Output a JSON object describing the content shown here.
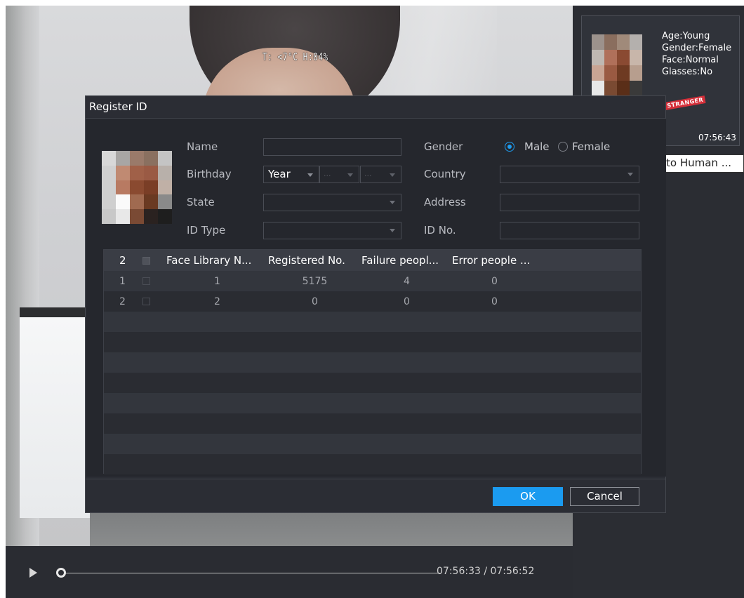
{
  "video": {
    "osd_text": "T: <7°C H:04%"
  },
  "playback": {
    "time": "07:56:33 / 07:56:52",
    "progress": 0.0
  },
  "right_panel": {
    "attributes": [
      "Age:Young",
      "Gender:Female",
      "Face:Normal",
      "Glasses:No"
    ],
    "stamp": "STRANGER",
    "capture_time": "07:56:43",
    "to_human_button": "to Human ..."
  },
  "dialog": {
    "title": "Register ID",
    "form": {
      "name_label": "Name",
      "name_value": "",
      "gender_label": "Gender",
      "gender_options": [
        "Male",
        "Female"
      ],
      "gender_selected": "Male",
      "birthday_label": "Birthday",
      "birthday_year": "Year",
      "birthday_month": "...",
      "birthday_day": "...",
      "country_label": "Country",
      "country_value": "",
      "state_label": "State",
      "state_value": "",
      "address_label": "Address",
      "address_value": "",
      "idtype_label": "ID Type",
      "idtype_value": "",
      "idno_label": "ID No.",
      "idno_value": ""
    },
    "table": {
      "count": "2",
      "headers": [
        "Face Library N...",
        "Registered No.",
        "Failure peopl...",
        "Error people ..."
      ],
      "rows": [
        {
          "index": "1",
          "library": "1",
          "registered": "5175",
          "failure": "4",
          "error": "0"
        },
        {
          "index": "2",
          "library": "2",
          "registered": "0",
          "failure": "0",
          "error": "0"
        }
      ]
    },
    "ok_label": "OK",
    "cancel_label": "Cancel"
  },
  "colors": {
    "accent": "#1b9bf0",
    "dialog_bg": "#2b2d34",
    "panel_bg": "#2b2d33",
    "stamp": "#d5303a"
  }
}
